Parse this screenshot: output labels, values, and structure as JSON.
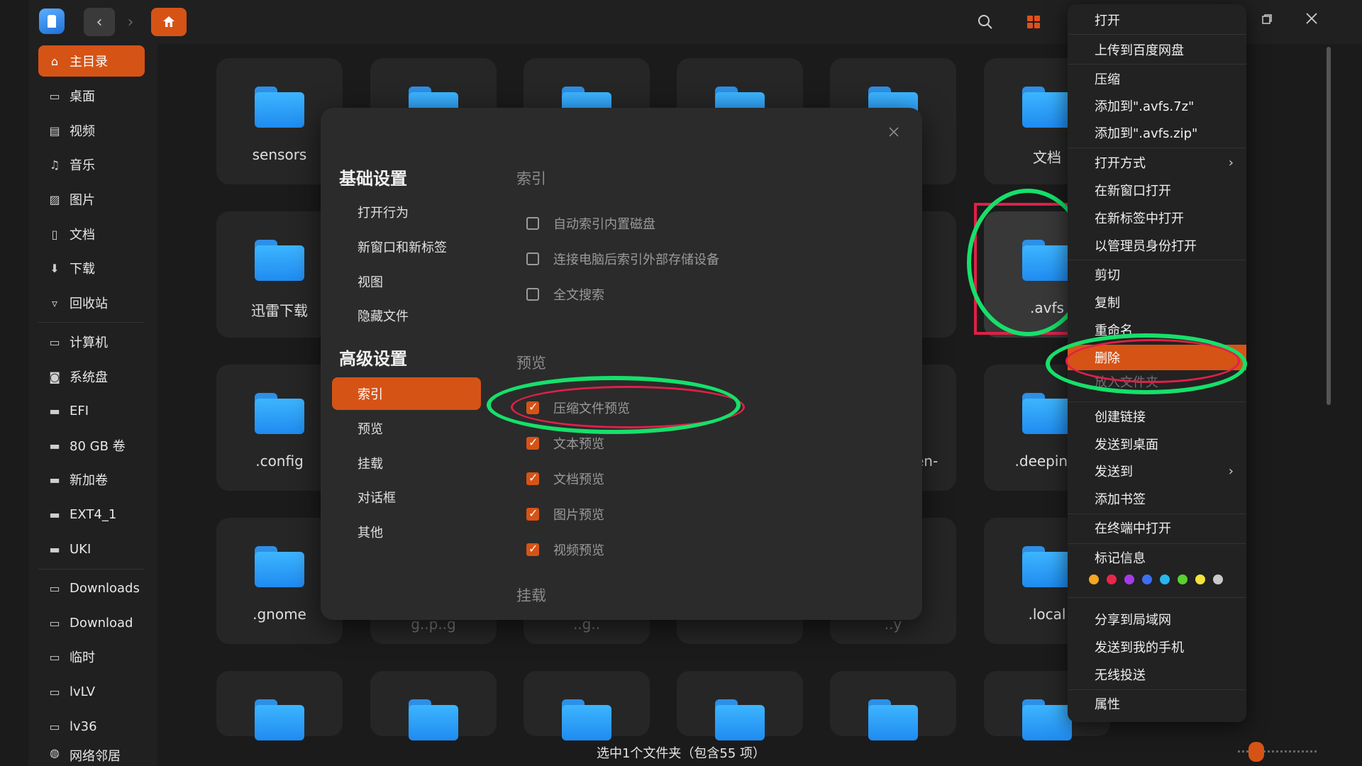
{
  "toolbar": {
    "back_icon": "‹",
    "forward_icon": "›"
  },
  "sidebar": {
    "items": [
      {
        "label": "主目录",
        "icon": "home-icon",
        "glyph": "⌂"
      },
      {
        "label": "桌面",
        "icon": "desktop-icon",
        "glyph": "▭"
      },
      {
        "label": "视频",
        "icon": "video-icon",
        "glyph": "▤"
      },
      {
        "label": "音乐",
        "icon": "music-icon",
        "glyph": "♫"
      },
      {
        "label": "图片",
        "icon": "picture-icon",
        "glyph": "▨"
      },
      {
        "label": "文档",
        "icon": "document-icon",
        "glyph": "▯"
      },
      {
        "label": "下载",
        "icon": "download-icon",
        "glyph": "⬇"
      },
      {
        "label": "回收站",
        "icon": "trash-icon",
        "glyph": "▿"
      },
      {
        "label": "计算机",
        "icon": "computer-icon",
        "glyph": "▭"
      },
      {
        "label": "系统盘",
        "icon": "system-disk-icon",
        "glyph": "◙"
      },
      {
        "label": "EFI",
        "icon": "disk-icon",
        "glyph": "▬"
      },
      {
        "label": "80 GB 卷",
        "icon": "disk-icon",
        "glyph": "▬"
      },
      {
        "label": "新加卷",
        "icon": "disk-icon",
        "glyph": "▬"
      },
      {
        "label": "EXT4_1",
        "icon": "disk-icon",
        "glyph": "▬"
      },
      {
        "label": "UKI",
        "icon": "disk-icon",
        "glyph": "▬"
      },
      {
        "label": "Downloads",
        "icon": "folder-icon",
        "glyph": "▭"
      },
      {
        "label": "Download",
        "icon": "folder-icon",
        "glyph": "▭"
      },
      {
        "label": "临时",
        "icon": "folder-icon",
        "glyph": "▭"
      },
      {
        "label": "lvLV",
        "icon": "folder-icon",
        "glyph": "▭"
      },
      {
        "label": "lv36",
        "icon": "folder-icon",
        "glyph": "▭"
      },
      {
        "label": "网络邻居",
        "icon": "network-icon",
        "glyph": "◍"
      }
    ]
  },
  "grid": {
    "row1": [
      "sensors",
      "",
      "",
      "",
      "",
      "文档"
    ],
    "row2": [
      "迅雷下载",
      ".avfs"
    ],
    "row3": [
      ".config",
      "en-",
      ".deepinw"
    ],
    "row4": [
      ".gnome",
      ".local"
    ],
    "row4_partial": [
      "g..p..g",
      "..g..",
      "..y"
    ]
  },
  "dialog": {
    "basic_title": "基础设置",
    "basic_items": [
      "打开行为",
      "新窗口和新标签",
      "视图",
      "隐藏文件"
    ],
    "advanced_title": "高级设置",
    "advanced_items": [
      "索引",
      "预览",
      "挂载",
      "对话框",
      "其他"
    ],
    "index_group": "索引",
    "index_options": [
      {
        "label": "自动索引内置磁盘",
        "checked": false
      },
      {
        "label": "连接电脑后索引外部存储设备",
        "checked": false
      },
      {
        "label": "全文搜索",
        "checked": false
      }
    ],
    "preview_group": "预览",
    "preview_options": [
      {
        "label": "压缩文件预览",
        "checked": true
      },
      {
        "label": "文本预览",
        "checked": true
      },
      {
        "label": "文档预览",
        "checked": true
      },
      {
        "label": "图片预览",
        "checked": true
      },
      {
        "label": "视频预览",
        "checked": true
      }
    ],
    "mount_group": "挂载"
  },
  "context_menu": {
    "items": [
      "打开",
      "上传到百度网盘",
      "压缩",
      "添加到\".avfs.7z\"",
      "添加到\".avfs.zip\"",
      "打开方式",
      "在新窗口打开",
      "在新标签中打开",
      "以管理员身份打开",
      "剪切",
      "复制",
      "重命名",
      "删除",
      "放入文件夹",
      "创建链接",
      "发送到桌面",
      "发送到",
      "添加书签",
      "在终端中打开",
      "标记信息",
      "分享到局域网",
      "发送到我的手机",
      "无线投送",
      "属性"
    ],
    "tag_colors": [
      "#f5a623",
      "#e8274b",
      "#a53be8",
      "#3b6ff5",
      "#26b6f0",
      "#58d22f",
      "#f3e33a",
      "#c9c9c9"
    ]
  },
  "status": {
    "text": "选中1个文件夹（包含55 项）"
  },
  "colors": {
    "accent": "#d65316",
    "annotation_green": "#16e06a",
    "annotation_red": "#e02048"
  }
}
